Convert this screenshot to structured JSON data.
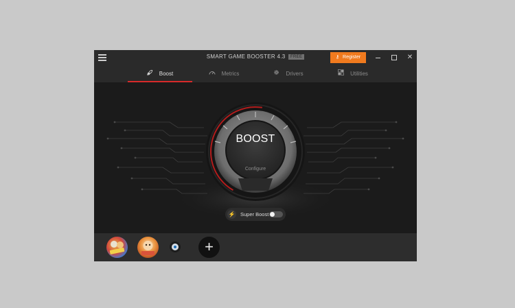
{
  "window": {
    "title": "SMART GAME BOOSTER 4.3",
    "edition_badge": "FREE",
    "register_label": "Register"
  },
  "tabs": [
    {
      "label": "Boost",
      "icon": "rocket-icon",
      "active": true
    },
    {
      "label": "Metrics",
      "icon": "speedometer-icon",
      "active": false
    },
    {
      "label": "Drivers",
      "icon": "gear-icon",
      "active": false
    },
    {
      "label": "Utilities",
      "icon": "grid-icon",
      "active": false
    }
  ],
  "main": {
    "boost_label": "BOOST",
    "configure_label": "Configure",
    "super_boost_label": "Super Boost",
    "super_boost_enabled": false
  },
  "games": [
    {
      "icon": "game-icon-friends"
    },
    {
      "icon": "game-icon-character"
    },
    {
      "icon": "game-icon-app"
    },
    {
      "icon": "add-icon"
    }
  ],
  "colors": {
    "accent": "#f07a1e",
    "active_tab_underline": "#d92a2a",
    "background": "#1b1b1b",
    "bar": "#2a2a2a"
  }
}
